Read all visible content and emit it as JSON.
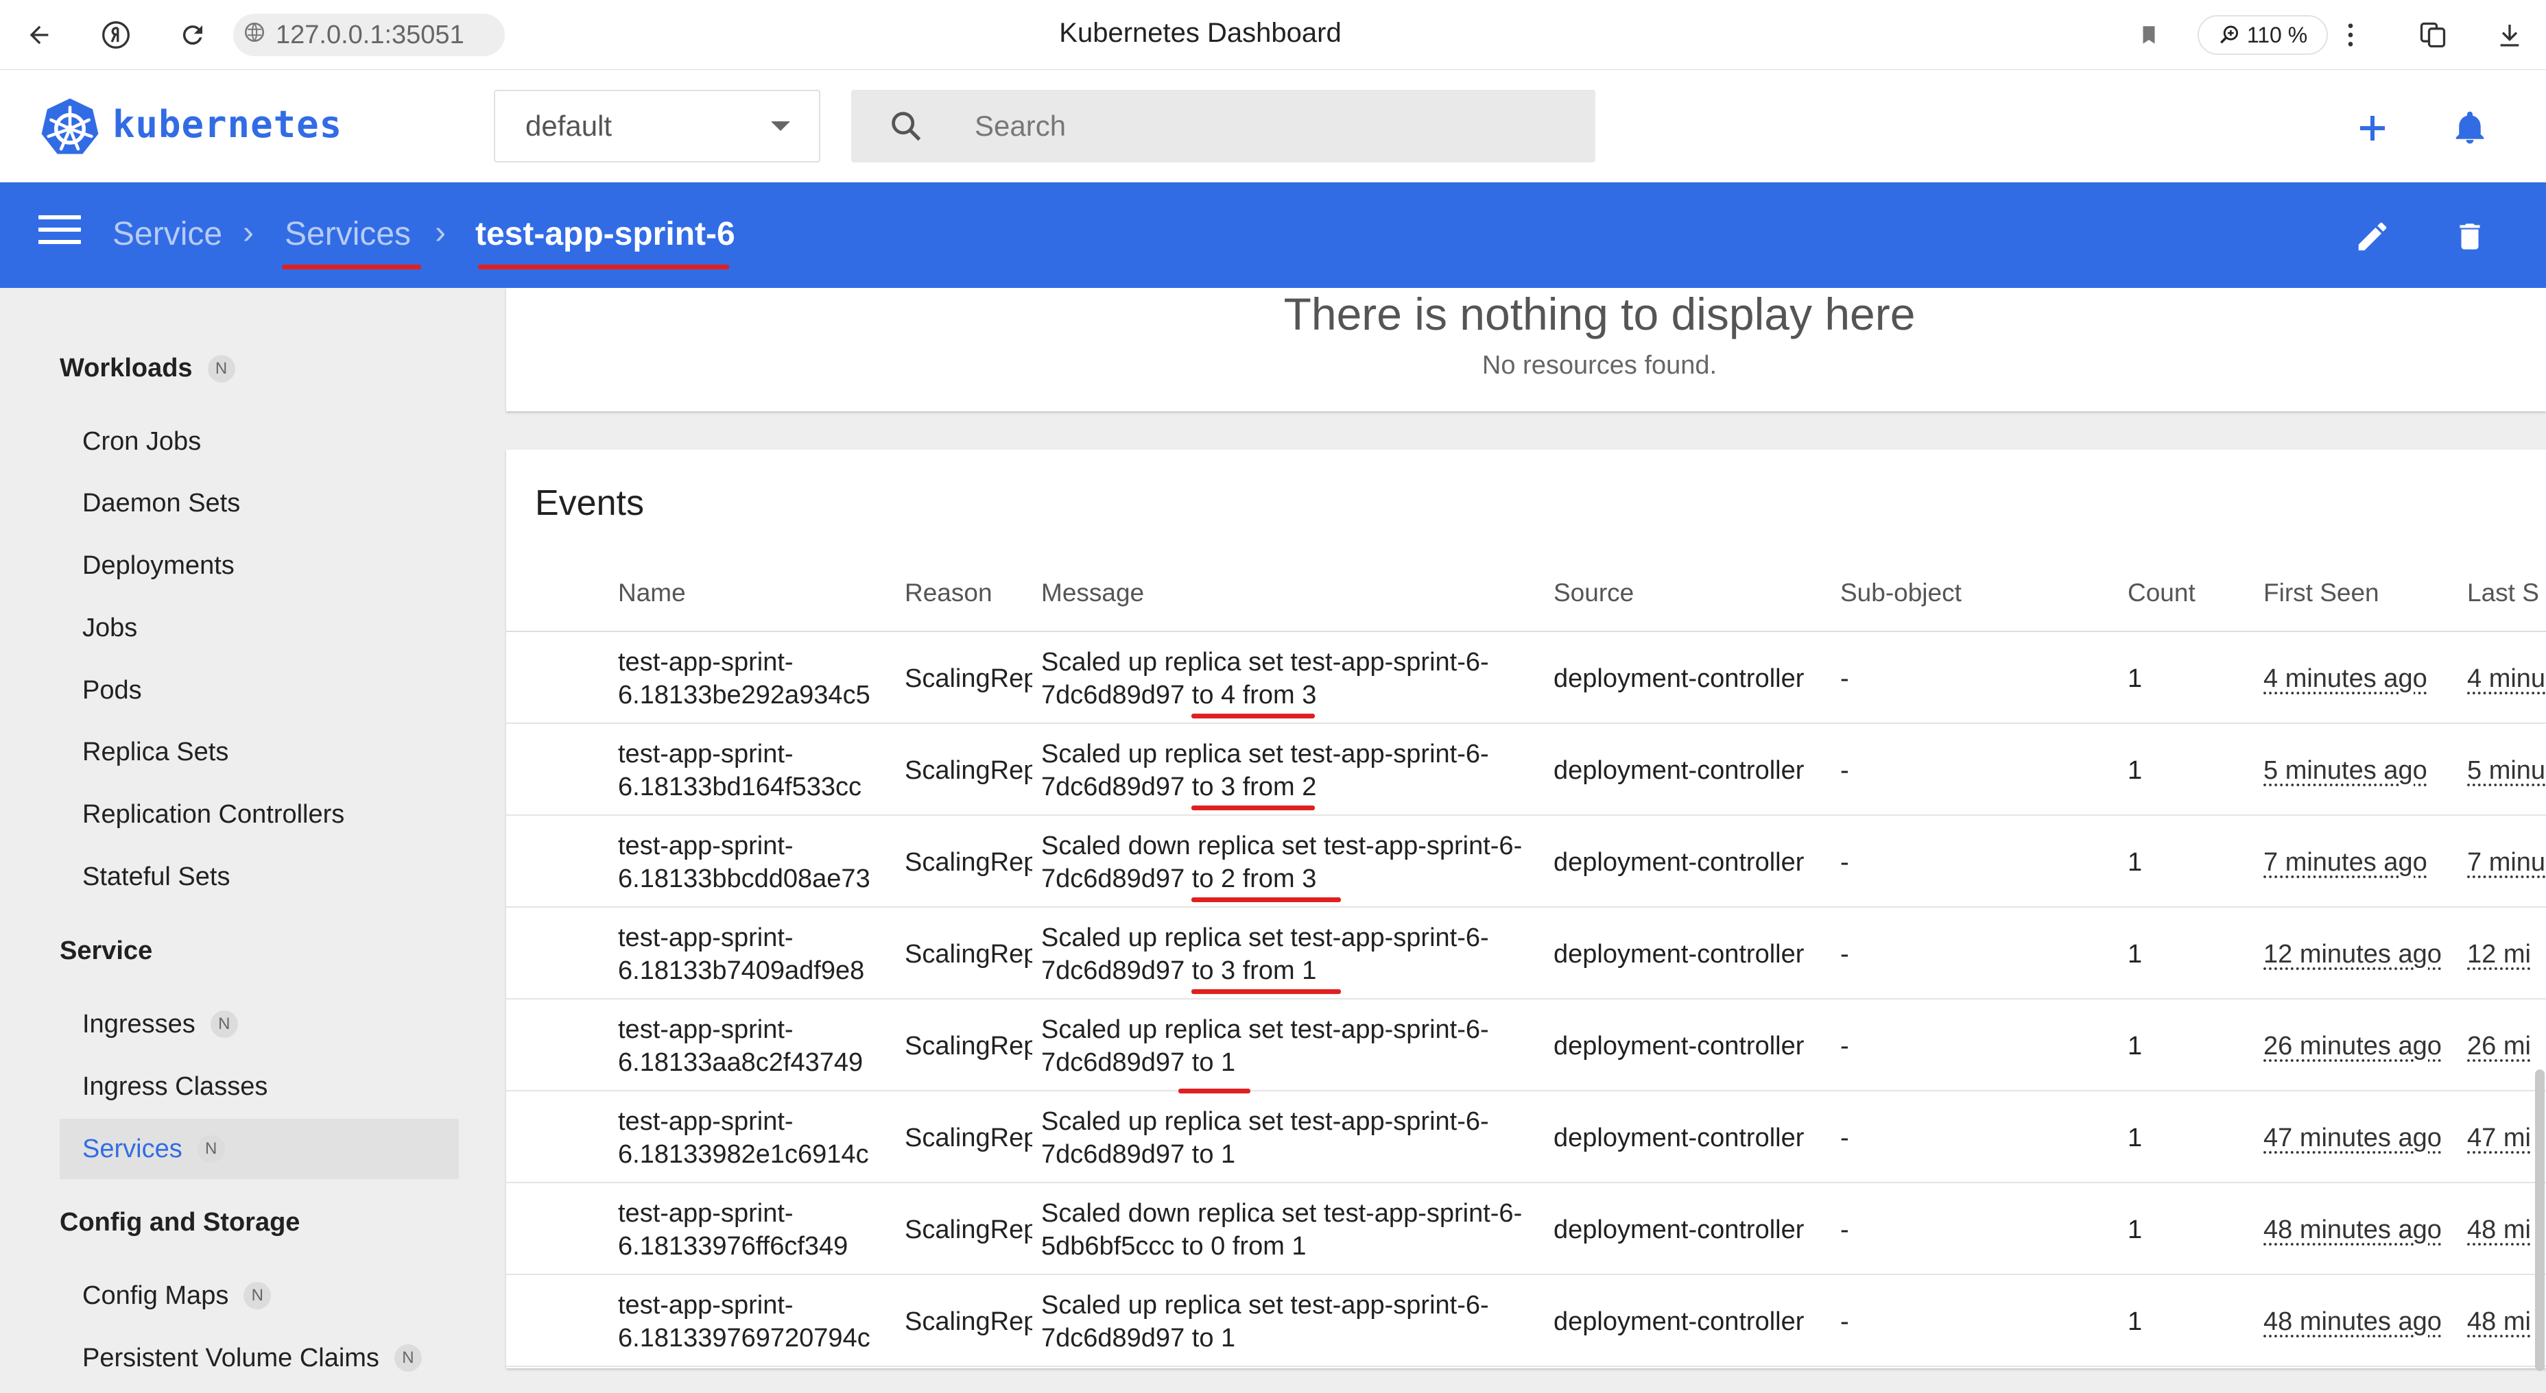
{
  "browser": {
    "url": "127.0.0.1:35051",
    "title": "Kubernetes Dashboard",
    "zoom": "110 %"
  },
  "app": {
    "logo_text": "kubernetes",
    "namespace": "default",
    "search_placeholder": "Search",
    "brand_color": "#326ce5"
  },
  "breadcrumb": {
    "items": [
      "Service",
      "Services",
      "test-app-sprint-6"
    ]
  },
  "sidebar": {
    "workloads": {
      "title": "Workloads",
      "badge": "N",
      "items": [
        "Cron Jobs",
        "Daemon Sets",
        "Deployments",
        "Jobs",
        "Pods",
        "Replica Sets",
        "Replication Controllers",
        "Stateful Sets"
      ]
    },
    "service": {
      "title": "Service",
      "items": [
        {
          "label": "Ingresses",
          "badge": "N"
        },
        {
          "label": "Ingress Classes",
          "badge": ""
        },
        {
          "label": "Services",
          "badge": "N"
        }
      ]
    },
    "config": {
      "title": "Config and Storage",
      "items": [
        {
          "label": "Config Maps",
          "badge": "N"
        },
        {
          "label": "Persistent Volume Claims",
          "badge": "N"
        }
      ]
    }
  },
  "empty_state": {
    "title": "There is nothing to display here",
    "subtitle": "No resources found."
  },
  "events": {
    "title": "Events",
    "columns": [
      "Name",
      "Reason",
      "Message",
      "Source",
      "Sub-object",
      "Count",
      "First Seen",
      "Last S"
    ],
    "rows": [
      {
        "name": [
          "test-app-sprint-",
          "6.18133be292a934c5"
        ],
        "reason": "ScalingRep",
        "message": [
          "Scaled up replica set test-app-sprint-6-",
          "7dc6d89d97 to 4 from 3"
        ],
        "source": "deployment-controller",
        "subobject": "-",
        "count": "1",
        "first_seen": "4 minutes ago",
        "last_seen": "4 minu"
      },
      {
        "name": [
          "test-app-sprint-",
          "6.18133bd164f533cc"
        ],
        "reason": "ScalingRep",
        "message": [
          "Scaled up replica set test-app-sprint-6-",
          "7dc6d89d97 to 3 from 2"
        ],
        "source": "deployment-controller",
        "subobject": "-",
        "count": "1",
        "first_seen": "5 minutes ago",
        "last_seen": "5 minu"
      },
      {
        "name": [
          "test-app-sprint-",
          "6.18133bbcdd08ae73"
        ],
        "reason": "ScalingRep",
        "message": [
          "Scaled down replica set test-app-sprint-6-",
          "7dc6d89d97 to 2 from 3"
        ],
        "source": "deployment-controller",
        "subobject": "-",
        "count": "1",
        "first_seen": "7 minutes ago",
        "last_seen": "7 minu"
      },
      {
        "name": [
          "test-app-sprint-",
          "6.18133b7409adf9e8"
        ],
        "reason": "ScalingRep",
        "message": [
          "Scaled up replica set test-app-sprint-6-",
          "7dc6d89d97 to 3 from 1"
        ],
        "source": "deployment-controller",
        "subobject": "-",
        "count": "1",
        "first_seen": "12 minutes ago",
        "last_seen": "12 mi"
      },
      {
        "name": [
          "test-app-sprint-",
          "6.18133aa8c2f43749"
        ],
        "reason": "ScalingRep",
        "message": [
          "Scaled up replica set test-app-sprint-6-",
          "7dc6d89d97 to 1"
        ],
        "source": "deployment-controller",
        "subobject": "-",
        "count": "1",
        "first_seen": "26 minutes ago",
        "last_seen": "26 mi"
      },
      {
        "name": [
          "test-app-sprint-",
          "6.18133982e1c6914c"
        ],
        "reason": "ScalingRep",
        "message": [
          "Scaled up replica set test-app-sprint-6-",
          "7dc6d89d97 to 1"
        ],
        "source": "deployment-controller",
        "subobject": "-",
        "count": "1",
        "first_seen": "47 minutes ago",
        "last_seen": "47 mi"
      },
      {
        "name": [
          "test-app-sprint-",
          "6.18133976ff6cf349"
        ],
        "reason": "ScalingRep",
        "message": [
          "Scaled down replica set test-app-sprint-6-",
          "5db6bf5ccc to 0 from 1"
        ],
        "source": "deployment-controller",
        "subobject": "-",
        "count": "1",
        "first_seen": "48 minutes ago",
        "last_seen": "48 mi"
      },
      {
        "name": [
          "test-app-sprint-",
          "6.181339769720794c"
        ],
        "reason": "ScalingRep",
        "message": [
          "Scaled up replica set test-app-sprint-6-",
          "7dc6d89d97 to 1"
        ],
        "source": "deployment-controller",
        "subobject": "-",
        "count": "1",
        "first_seen": "48 minutes ago",
        "last_seen": "48 mi"
      }
    ]
  }
}
